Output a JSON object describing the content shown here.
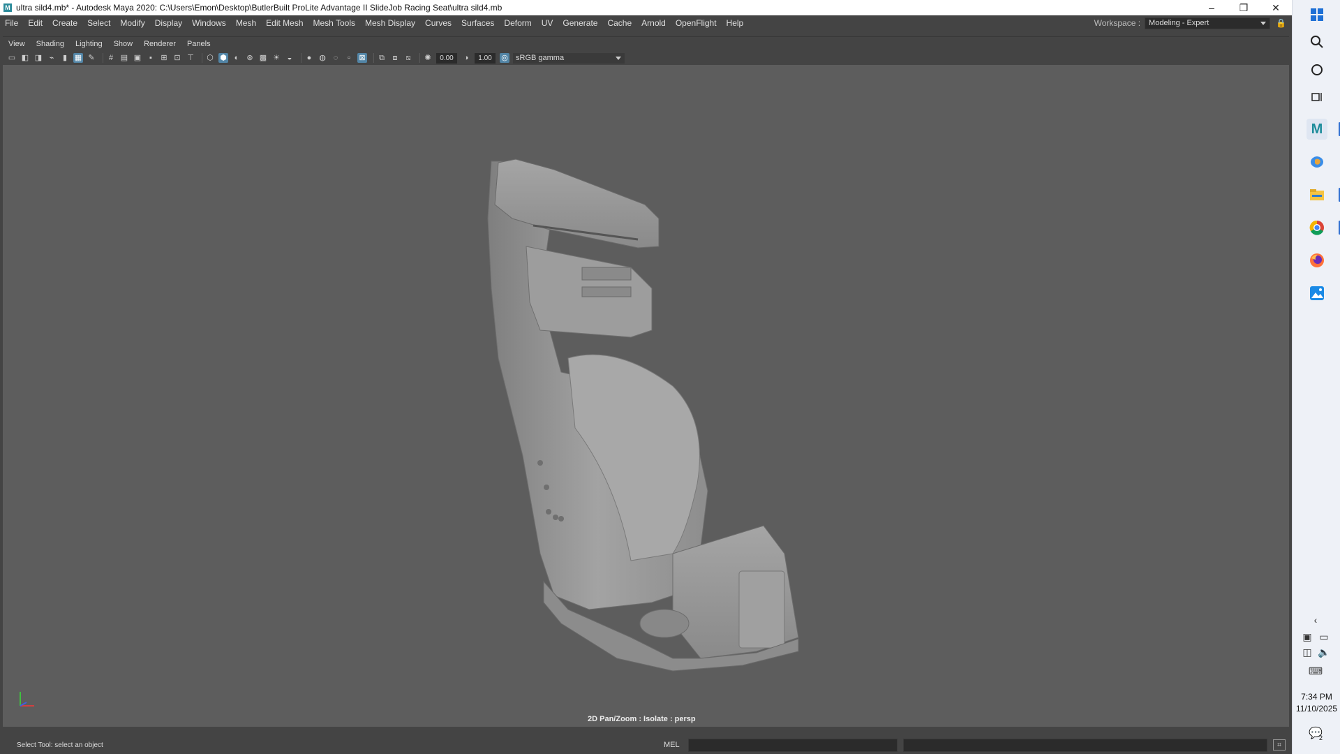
{
  "window": {
    "title": "ultra sild4.mb* - Autodesk Maya 2020: C:\\Users\\Emon\\Desktop\\ButlerBuilt ProLite Advantage II SlideJob Racing Seat\\ultra sild4.mb",
    "app_icon_letter": "M",
    "minimize": "–",
    "restore": "❐",
    "close": "✕"
  },
  "menubar": {
    "items": [
      "File",
      "Edit",
      "Create",
      "Select",
      "Modify",
      "Display",
      "Windows",
      "Mesh",
      "Edit Mesh",
      "Mesh Tools",
      "Mesh Display",
      "Curves",
      "Surfaces",
      "Deform",
      "UV",
      "Generate",
      "Cache",
      "Arnold",
      "OpenFlight",
      "Help"
    ],
    "workspace_label": "Workspace :",
    "workspace_value": "Modeling - Expert"
  },
  "panel_menu": [
    "View",
    "Shading",
    "Lighting",
    "Show",
    "Renderer",
    "Panels"
  ],
  "panel_toolbar": {
    "exposure": "0.00",
    "gamma": "1.00",
    "color_space": "sRGB gamma"
  },
  "viewport": {
    "label": "2D Pan/Zoom : Isolate : persp",
    "background": "#5d5d5d",
    "model_color": "#9a9a9a"
  },
  "statusbar": {
    "help_line": "Select Tool: select an object",
    "mel_label": "MEL"
  },
  "taskbar": {
    "time": "7:34 PM",
    "date": "11/10/2025",
    "notification_count": "2"
  }
}
